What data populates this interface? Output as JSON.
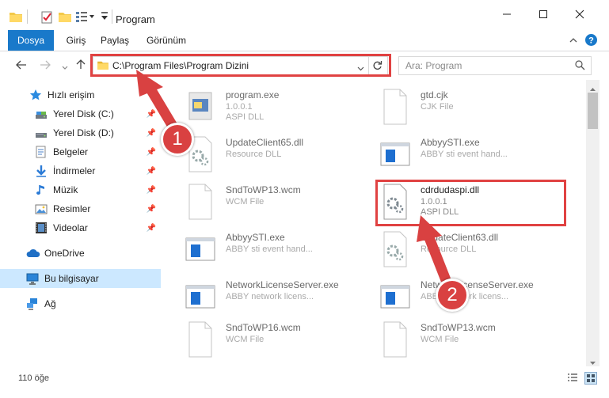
{
  "window": {
    "title": "Program",
    "minimize_icon": "minimize-icon",
    "maximize_icon": "maximize-icon",
    "close_icon": "close-icon"
  },
  "ribbon": {
    "tabs": [
      {
        "label": "Dosya",
        "active": true
      },
      {
        "label": "Giriş"
      },
      {
        "label": "Paylaş"
      },
      {
        "label": "Görünüm"
      }
    ]
  },
  "address": {
    "path": "C:\\Program Files\\Program Dizini",
    "search_placeholder": "Ara: Program"
  },
  "nav": {
    "items": [
      {
        "label": "Hızlı erişim",
        "icon": "star-icon"
      },
      {
        "label": "Yerel Disk (C:)",
        "icon": "drive-icon",
        "pinned": true
      },
      {
        "label": "Yerel Disk (D:)",
        "icon": "drive-icon",
        "pinned": true
      },
      {
        "label": "Belgeler",
        "icon": "documents-icon",
        "pinned": true
      },
      {
        "label": "İndirmeler",
        "icon": "download-icon",
        "pinned": true
      },
      {
        "label": "Müzik",
        "icon": "music-icon",
        "pinned": true
      },
      {
        "label": "Resimler",
        "icon": "pictures-icon",
        "pinned": true
      },
      {
        "label": "Videolar",
        "icon": "videos-icon",
        "pinned": true
      },
      {
        "label": "OneDrive",
        "icon": "cloud-icon"
      },
      {
        "label": "Bu bilgisayar",
        "icon": "computer-icon",
        "selected": true
      },
      {
        "label": "Ağ",
        "icon": "network-icon"
      }
    ]
  },
  "files": [
    {
      "name": "program.exe",
      "line2": "1.0.0.1",
      "line3": "ASPI DLL",
      "icon": "program-icon"
    },
    {
      "name": "gtd.cjk",
      "line2": "CJK File",
      "line3": "",
      "icon": "blank-file-icon"
    },
    {
      "name": "UpdateClient65.dll",
      "line2": "Resource DLL",
      "line3": "",
      "icon": "dll-gear-icon"
    },
    {
      "name": "AbbyySTI.exe",
      "line2": "ABBY sti event hand...",
      "line3": "",
      "icon": "app-window-icon"
    },
    {
      "name": "SndToWP13.wcm",
      "line2": "WCM File",
      "line3": "",
      "icon": "blank-file-icon"
    },
    {
      "name": "cdrdudaspi.dll",
      "line2": "1.0.0.1",
      "line3": "ASPI DLL",
      "icon": "dll-gear-icon",
      "highlighted": true
    },
    {
      "name": "AbbyySTI.exe",
      "line2": "ABBY sti event hand...",
      "line3": "",
      "icon": "app-window-icon"
    },
    {
      "name": "UpdateClient63.dll",
      "line2": "Resource DLL",
      "line3": "",
      "icon": "dll-gear-icon"
    },
    {
      "name": "NetworkLicenseServer.exe",
      "line2": "ABBY network licens...",
      "line3": "",
      "icon": "app-window-icon"
    },
    {
      "name": "NetworkLicenseServer.exe",
      "line2": "ABBY network licens...",
      "line3": "",
      "icon": "app-window-icon"
    },
    {
      "name": "SndToWP16.wcm",
      "line2": "WCM File",
      "line3": "",
      "icon": "blank-file-icon"
    },
    {
      "name": "SndToWP13.wcm",
      "line2": "WCM File",
      "line3": "",
      "icon": "blank-file-icon"
    }
  ],
  "status": {
    "count": "110 öğe"
  },
  "annotations": {
    "step1": "1",
    "step2": "2",
    "color": "#d94141"
  },
  "colors": {
    "accent": "#1979ca",
    "selected_nav": "#cce8ff",
    "highlight": "#e04242"
  }
}
